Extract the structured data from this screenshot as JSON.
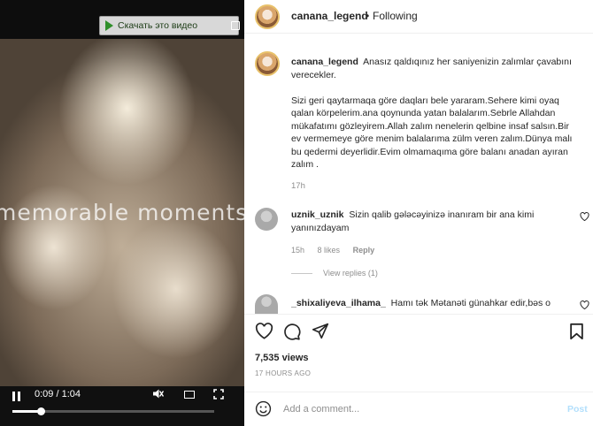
{
  "media": {
    "watermark": "memorable moments",
    "download_button_label": "Скачать это видео",
    "icons": {
      "download": "play-triangle-icon",
      "expand": "expand-icon"
    },
    "player": {
      "time_display": "0:09 / 1:04",
      "progress_fraction": 0.14,
      "icons": [
        "pause-icon",
        "mute-icon",
        "picture-in-picture-icon",
        "fullscreen-icon"
      ]
    }
  },
  "header": {
    "username": "canana_legend",
    "separator": "•",
    "follow_status": "Following"
  },
  "caption": {
    "username": "canana_legend",
    "paragraphs": [
      "Anasız qaldıqınız her saniyenizin zalımlar çavabını verecekler.",
      "Sizi geri qaytarmaqa göre daqları bele yararam.Sehere kimi oyaq qalan körpelerim.ana qoynunda yatan balalarım.Sebrle Allahdan mükafatımı gözleyirem.Allah zalım nenelerin qelbine insaf salsın.Bir ev vermemeye göre menim balalarıma zülm veren zalım.Dünya malı bu qedermi deyerlidir.Evim olmamaqıma göre balanı anadan ayıran zalım ."
    ],
    "time": "17h"
  },
  "comments": [
    {
      "username": "uznik_uznik",
      "text": "Sizin qalib gələcəyinizə inanıram bir ana kimi yanınızdayam",
      "time": "15h",
      "likes": "8 likes",
      "reply": "Reply",
      "view_replies": "View replies (1)"
    },
    {
      "username": "_shixaliyeva_ilhama_",
      "text": "Hamı tək Mətanəti günahkar edir,bəs o"
    }
  ],
  "actions": {
    "icons": [
      "heart-icon",
      "comment-icon",
      "share-icon",
      "bookmark-icon"
    ],
    "views": "7,535 views",
    "posted_ago": "17 HOURS AGO"
  },
  "add_comment": {
    "placeholder": "Add a comment...",
    "post_label": "Post"
  },
  "colors": {
    "accent_disabled": "#b2dffc",
    "meta_gray": "#8e8e8e",
    "text": "#262626"
  }
}
